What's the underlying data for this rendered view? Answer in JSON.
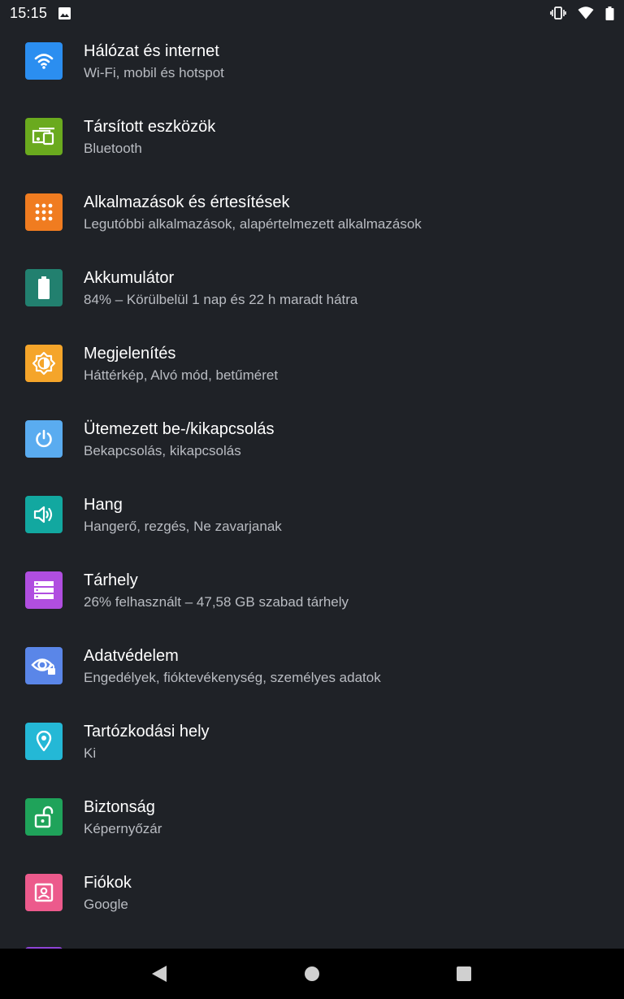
{
  "status_bar": {
    "time": "15:15",
    "icons": [
      "image-notification-icon",
      "vibrate-icon",
      "wifi-icon",
      "battery-icon"
    ]
  },
  "settings": [
    {
      "title": "Hálózat és internet",
      "subtitle": "Wi-Fi, mobil és hotspot",
      "icon": "wifi-icon",
      "color": "#2b8ef0"
    },
    {
      "title": "Társított eszközök",
      "subtitle": "Bluetooth",
      "icon": "devices-icon",
      "color": "#6aaa1e"
    },
    {
      "title": "Alkalmazások és értesítések",
      "subtitle": "Legutóbbi alkalmazások, alapértelmezett alkalmazások",
      "icon": "apps-grid-icon",
      "color": "#f07c20"
    },
    {
      "title": "Akkumulátor",
      "subtitle": "84% – Körülbelül 1 nap és 22 h maradt hátra",
      "icon": "battery-icon",
      "color": "#22806f"
    },
    {
      "title": "Megjelenítés",
      "subtitle": "Háttérkép, Alvó mód, betűméret",
      "icon": "brightness-icon",
      "color": "#f5a52a"
    },
    {
      "title": "Ütemezett be-/kikapcsolás",
      "subtitle": "Bekapcsolás, kikapcsolás",
      "icon": "power-icon",
      "color": "#5aacf0"
    },
    {
      "title": "Hang",
      "subtitle": "Hangerő, rezgés, Ne zavarjanak",
      "icon": "volume-icon",
      "color": "#12a8a0"
    },
    {
      "title": "Tárhely",
      "subtitle": "26% felhasznált – 47,58 GB szabad tárhely",
      "icon": "storage-icon",
      "color": "#b04ee0"
    },
    {
      "title": "Adatvédelem",
      "subtitle": "Engedélyek, fióktevékenység, személyes adatok",
      "icon": "privacy-eye-icon",
      "color": "#5a86e8"
    },
    {
      "title": "Tartózkodási hely",
      "subtitle": "Ki",
      "icon": "location-pin-icon",
      "color": "#24b8d6"
    },
    {
      "title": "Biztonság",
      "subtitle": "Képernyőzár",
      "icon": "lock-open-icon",
      "color": "#1fa35a"
    },
    {
      "title": "Fiókok",
      "subtitle": "Google",
      "icon": "account-icon",
      "color": "#ec5a8c"
    }
  ],
  "navbar": {
    "buttons": [
      "back-icon",
      "home-icon",
      "recents-icon"
    ]
  }
}
